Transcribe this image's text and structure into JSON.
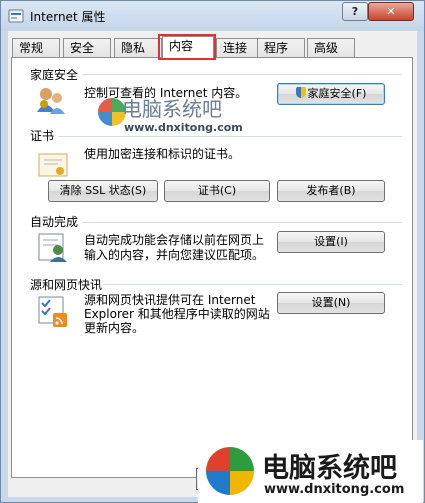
{
  "window": {
    "title": "Internet 属性",
    "help_label": "?",
    "close_label": "✕"
  },
  "tabs": [
    {
      "label": "常规"
    },
    {
      "label": "安全"
    },
    {
      "label": "隐私"
    },
    {
      "label": "内容",
      "active": true
    },
    {
      "label": "连接"
    },
    {
      "label": "程序"
    },
    {
      "label": "高级"
    }
  ],
  "family_safety": {
    "title": "家庭安全",
    "description": "控制可查看的 Internet 内容。",
    "button": "家庭安全(F)"
  },
  "certificates": {
    "title": "证书",
    "description": "使用加密连接和标识的证书。",
    "buttons": {
      "clear_ssl": "清除 SSL 状态(S)",
      "certificates": "证书(C)",
      "publishers": "发布者(B)"
    }
  },
  "autocomplete": {
    "title": "自动完成",
    "description_line1": "自动完成功能会存储以前在网页上",
    "description_line2": "输入的内容，并向您建议匹配项。",
    "button": "设置(I)"
  },
  "feeds": {
    "title": "源和网页快讯",
    "description_line1": "源和网页快讯提供可在 Internet",
    "description_line2": "Explorer 和其他程序中读取的网站",
    "description_line3": "更新内容。",
    "button": "设置(N)"
  },
  "footer": {
    "ok_partial": "确"
  },
  "watermark": {
    "brand": "电脑系统吧",
    "url": "www.dnxitong.com"
  },
  "colors": {
    "highlight": "#e03030",
    "close_red": "#c8442c"
  }
}
